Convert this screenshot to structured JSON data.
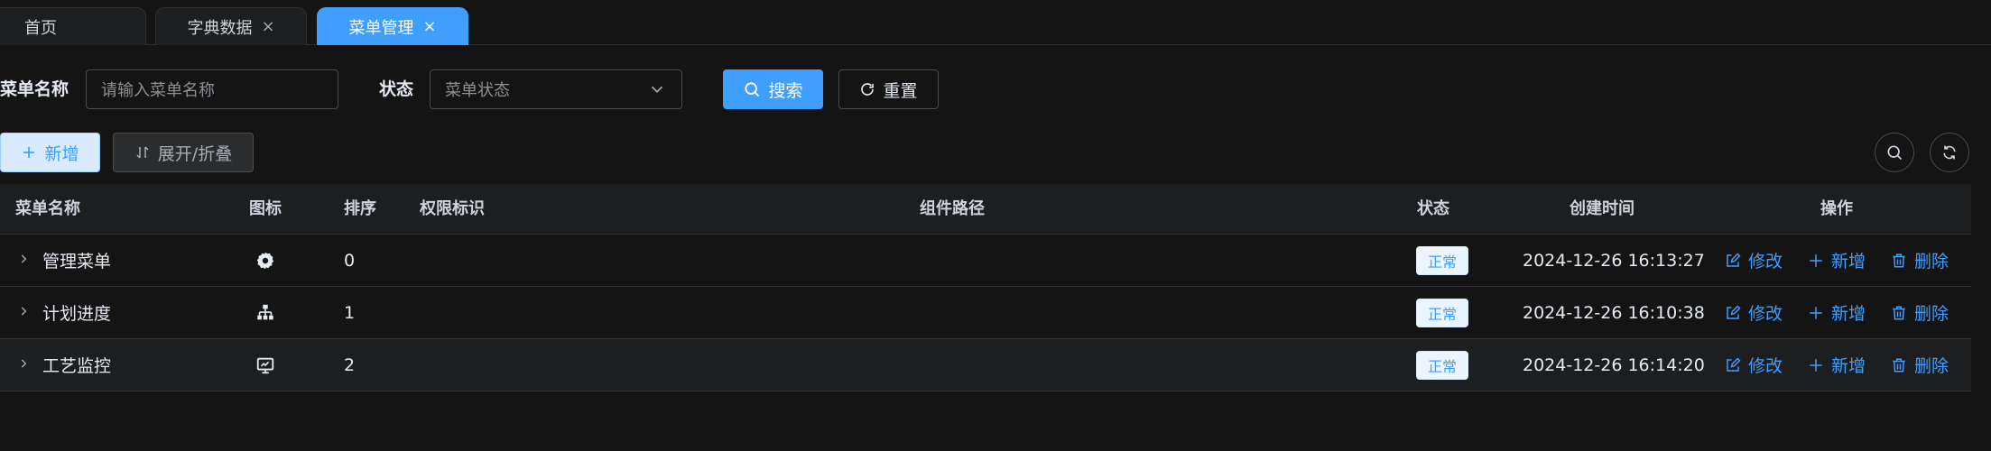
{
  "tabs": [
    {
      "label": "首页",
      "closable": false,
      "active": false
    },
    {
      "label": "字典数据",
      "closable": true,
      "active": false
    },
    {
      "label": "菜单管理",
      "closable": true,
      "active": true
    }
  ],
  "tab_close_glyph": "×",
  "search": {
    "menu_name_label": "菜单名称",
    "menu_name_placeholder": "请输入菜单名称",
    "status_label": "状态",
    "status_placeholder": "菜单状态",
    "search_button": "搜索",
    "reset_button": "重置"
  },
  "toolbar": {
    "add_button": "新增",
    "expand_button": "展开/折叠"
  },
  "table": {
    "headers": {
      "name": "菜单名称",
      "icon": "图标",
      "order": "排序",
      "perms": "权限标识",
      "component": "组件路径",
      "status": "状态",
      "created": "创建时间",
      "actions": "操作"
    },
    "rows": [
      {
        "name": "管理菜单",
        "icon": "gear-icon",
        "order": "0",
        "perms": "",
        "component": "",
        "status": "正常",
        "created": "2024-12-26 16:13:27"
      },
      {
        "name": "计划进度",
        "icon": "tree-structure-icon",
        "order": "1",
        "perms": "",
        "component": "",
        "status": "正常",
        "created": "2024-12-26 16:10:38"
      },
      {
        "name": "工艺监控",
        "icon": "monitor-icon",
        "order": "2",
        "perms": "",
        "component": "",
        "status": "正常",
        "created": "2024-12-26 16:14:20"
      }
    ],
    "actions": {
      "edit": "修改",
      "add": "新增",
      "delete": "删除"
    }
  },
  "colors": {
    "background": "#141414",
    "primary": "#409eff",
    "header_bg": "#1d1e1f",
    "border": "#363637"
  }
}
